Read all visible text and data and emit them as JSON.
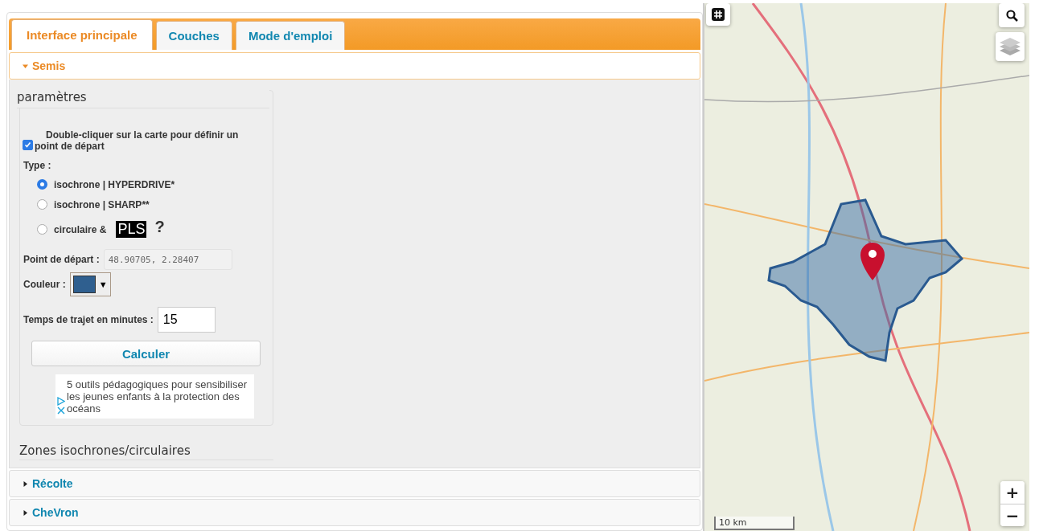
{
  "tabs": [
    {
      "label": "Interface principale",
      "selected": true
    },
    {
      "label": "Couches",
      "selected": false
    },
    {
      "label": "Mode d'emploi",
      "selected": false
    }
  ],
  "sections": [
    {
      "title": "Semis",
      "expanded": true
    },
    {
      "title": "Récolte",
      "expanded": false
    },
    {
      "title": "CheVron",
      "expanded": false
    }
  ],
  "params": {
    "legend": "paramètres",
    "checkbox": {
      "label": "Double-cliquer sur la carte pour définir un point de départ",
      "checked": true
    },
    "type_label": "Type :",
    "radios": [
      {
        "label": "isochrone | HYPERDRIVE*",
        "selected": true
      },
      {
        "label": "isochrone | SHARP**",
        "selected": false
      },
      {
        "label": "circulaire &",
        "selected": false,
        "badge": "PLS",
        "help": "?"
      }
    ],
    "start_point": {
      "label": "Point de départ :",
      "value": "48.90705, 2.28407"
    },
    "color": {
      "label": "Couleur :",
      "color": "#2f5f8f",
      "caret": "▼"
    },
    "travel_time": {
      "label": "Temps de trajet en minutes :",
      "value": "15"
    },
    "button": "Calculer",
    "ad": "5 outils pédagogiques pour sensibiliser les jeunes enfants à la protection des océans"
  },
  "zones_legend": "Zones isochrones/circulaires",
  "map": {
    "scale": "10 km",
    "zoom_in": "+",
    "zoom_out": "−"
  }
}
